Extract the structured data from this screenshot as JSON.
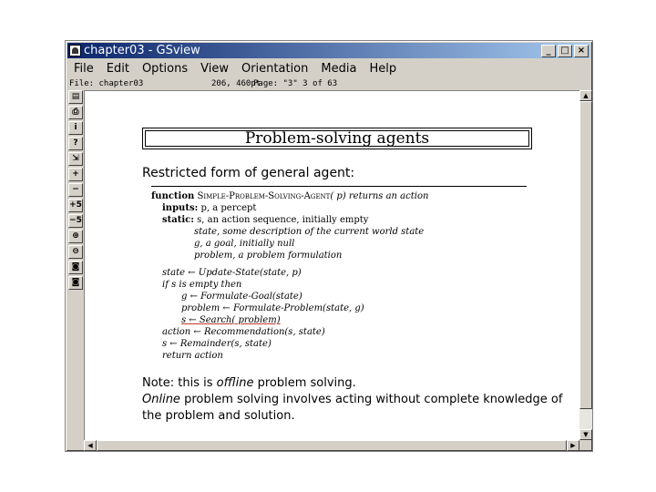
{
  "window": {
    "title": "chapter03 - GSview",
    "controls": [
      "_",
      "□",
      "×"
    ]
  },
  "menubar": [
    "File",
    "Edit",
    "Options",
    "View",
    "Orientation",
    "Media",
    "Help"
  ],
  "status": {
    "file": "File: chapter03",
    "coords": "206, 460pt",
    "page": "Page: \"3\" 3 of 63"
  },
  "toolbar": [
    {
      "icon": "open-icon",
      "glyph": "▤"
    },
    {
      "icon": "print-icon",
      "glyph": "⎙"
    },
    {
      "icon": "info-icon",
      "glyph": "i"
    },
    {
      "icon": "help-icon",
      "glyph": "?"
    },
    {
      "icon": "goto-page-icon",
      "glyph": "⇲"
    },
    {
      "icon": "next-page-icon",
      "glyph": "+"
    },
    {
      "icon": "prev-page-icon",
      "glyph": "−"
    },
    {
      "icon": "skip-forward-icon",
      "glyph": "+5"
    },
    {
      "icon": "skip-back-icon",
      "glyph": "−5"
    },
    {
      "icon": "zoom-in-icon",
      "glyph": "⊕"
    },
    {
      "icon": "zoom-out-icon",
      "glyph": "⊖"
    },
    {
      "icon": "find-icon",
      "glyph": "◙"
    },
    {
      "icon": "find-next-icon",
      "glyph": "◙"
    }
  ],
  "slide": {
    "title": "Problem-solving agents",
    "subtitle": "Restricted form of general agent:",
    "code": {
      "l1_kw": "function",
      "l1_name": "Simple-Problem-Solving-Agent",
      "l1_rest": "( p) returns an action",
      "l2_kw": "inputs:",
      "l2_rest": "p, a percept",
      "l3_kw": "static:",
      "l3_rest": "s, an action sequence, initially empty",
      "l4": "state, some description of the current world state",
      "l5": "g, a goal, initially null",
      "l6": "problem, a problem formulation",
      "l7": "state ← Update-State(state, p)",
      "l8": "if s is empty then",
      "l9": "g ← Formulate-Goal(state)",
      "l10": "problem ← Formulate-Problem(state, g)",
      "l11": "s ← Search( problem)",
      "l12": "action ← Recommendation(s, state)",
      "l13": "s ← Remainder(s, state)",
      "l14": "return action"
    },
    "note1_prefix": "Note: this is ",
    "note1_em": "offline",
    "note1_suffix": " problem solving.",
    "note2_em": "Online",
    "note2_line1": " problem solving involves acting without complete knowledge of",
    "note2_line2": "the problem and solution."
  }
}
